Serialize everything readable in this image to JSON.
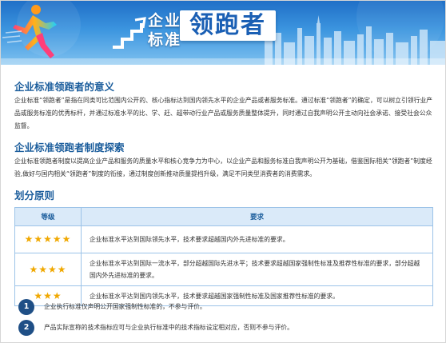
{
  "banner": {
    "line1": "企业",
    "line2": "标准",
    "title": "领跑者"
  },
  "sections": {
    "meaning": {
      "heading": "企业标准领跑者的意义",
      "body": "企业标准“领跑者”是指在同类可比范围内公开的、核心指标达到国内领先水平的企业产品或者服务标准。通过标准“领跑者”的确定，可以树立引领行业产品或服务标准的优秀标杆，并通过标准水平的比、学、赶、超带动行业产品或服务质量整体提升，同时通过自我声明公开主动向社会承诺、接受社会公众监督。"
    },
    "system": {
      "heading": "企业标准领跑者制度探索",
      "body": "企业标准领跑者制度以提高企业产品和服务的质量水平和核心竞争力为中心，以企业产品和服务标准自我声明公开为基础，借鉴国际相关“领跑者”制度经验,做好与国内相关“领跑者”制度的衔接，通过制度创新推动质量提档升级，满足不同类型消费者的消费需求。"
    },
    "principles": {
      "heading": "划分原则"
    }
  },
  "table": {
    "headers": [
      "等级",
      "要求"
    ],
    "rows": [
      {
        "stars": "★★★★★",
        "text": "企业标准水平达到国际领先水平，技术要求超越国内外先进标准的要求。"
      },
      {
        "stars": "★★★★",
        "text": "企业标准水平达到国际一流水平，部分超越国际先进水平；技术要求超越国家强制性标准及推荐性标准的要求，部分超越国内外先进标准的要求。"
      },
      {
        "stars": "★★★",
        "text": "企业标准水平达到国内领先水平，技术要求超越国家强制性标准及国家推荐性标准的要求。"
      }
    ]
  },
  "notes": [
    {
      "num": "1",
      "text": "企业执行标准仅声明公开国家强制性标准的，不参与评价。"
    },
    {
      "num": "2",
      "text": "产品实际宣称的技术指标应可与企业执行标准中的技术指标设定相对应，否则不参与评价。"
    }
  ],
  "colors": {
    "accent": "#1b5d9c",
    "star": "#f0a800",
    "header_bg": "#daeaf9",
    "badge": "#1f4f86"
  }
}
